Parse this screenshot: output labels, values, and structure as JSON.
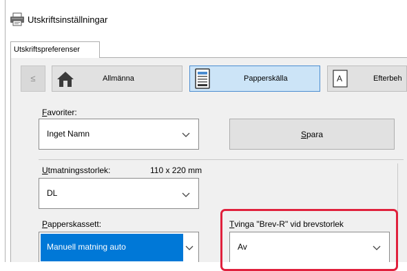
{
  "window": {
    "title": "Utskriftsinställningar"
  },
  "tab": {
    "label": "Utskriftspreferenser"
  },
  "nav": {
    "back_label": "≤",
    "items": [
      {
        "label": "Allmänna",
        "icon": "home-icon"
      },
      {
        "label": "Papperskälla",
        "icon": "paper-tray-icon"
      },
      {
        "label": "Efterbeh",
        "icon": "finishing-icon"
      }
    ]
  },
  "favorites": {
    "label_first": "F",
    "label_rest": "avoriter:",
    "value": "Inget Namn",
    "save_first": "S",
    "save_rest": "para"
  },
  "output_size": {
    "label_first": "U",
    "label_rest": "tmatningsstorlek:",
    "dimensions": "110 x 220 mm",
    "value": "DL"
  },
  "paper_tray": {
    "label_first": "P",
    "label_rest": "apperskassett:",
    "value": "Manuell matning auto"
  },
  "force_envelope": {
    "label_first": "T",
    "label_rest": "vinga \"Brev-R\" vid brevstorlek",
    "value": "Av"
  },
  "colors": {
    "selected_bg": "#0078d7",
    "active_tab_bg": "#cce4f7",
    "highlight": "#e0203c"
  }
}
